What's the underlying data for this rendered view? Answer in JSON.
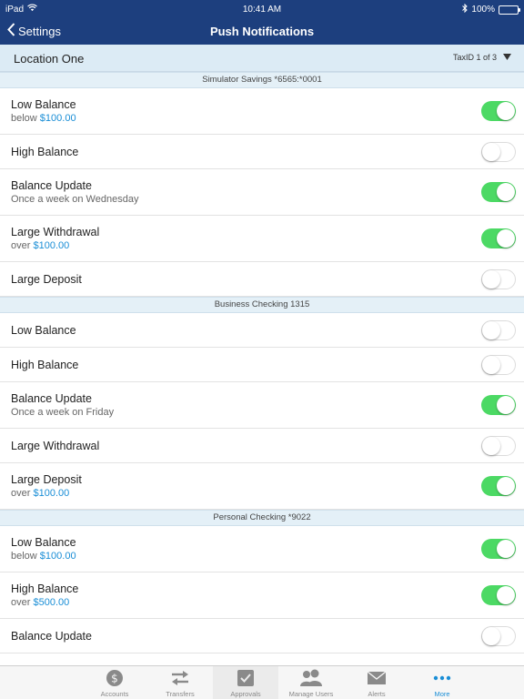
{
  "status_bar": {
    "device": "iPad",
    "time": "10:41 AM",
    "battery": "100%"
  },
  "nav": {
    "back_label": "Settings",
    "title": "Push Notifications"
  },
  "location": {
    "name": "Location One",
    "taxid": "TaxID 1 of 3"
  },
  "sections": [
    {
      "header": "Simulator Savings *6565:*0001",
      "rows": [
        {
          "title": "Low Balance",
          "prefix": "below ",
          "amount": "$100.00",
          "on": true
        },
        {
          "title": "High Balance",
          "on": false
        },
        {
          "title": "Balance Update",
          "prefix": "Once a week on Wednesday",
          "on": true
        },
        {
          "title": "Large Withdrawal",
          "prefix": "over ",
          "amount": "$100.00",
          "on": true
        },
        {
          "title": "Large Deposit",
          "on": false
        }
      ]
    },
    {
      "header": "Business Checking 1315",
      "rows": [
        {
          "title": "Low Balance",
          "on": false
        },
        {
          "title": "High Balance",
          "on": false
        },
        {
          "title": "Balance Update",
          "prefix": "Once a week on Friday",
          "on": true
        },
        {
          "title": "Large Withdrawal",
          "on": false
        },
        {
          "title": "Large Deposit",
          "prefix": "over ",
          "amount": "$100.00",
          "on": true
        }
      ]
    },
    {
      "header": "Personal Checking *9022",
      "rows": [
        {
          "title": "Low Balance",
          "prefix": "below ",
          "amount": "$100.00",
          "on": true
        },
        {
          "title": "High Balance",
          "prefix": "over ",
          "amount": "$500.00",
          "on": true
        },
        {
          "title": "Balance Update",
          "on": false
        }
      ]
    }
  ],
  "tabs": [
    {
      "label": "Accounts",
      "icon": "dollar-coin-icon"
    },
    {
      "label": "Transfers",
      "icon": "transfer-arrows-icon"
    },
    {
      "label": "Approvals",
      "icon": "checkbox-icon"
    },
    {
      "label": "Manage Users",
      "icon": "users-icon"
    },
    {
      "label": "Alerts",
      "icon": "envelope-icon"
    },
    {
      "label": "More",
      "icon": "more-dots-icon"
    }
  ],
  "colors": {
    "nav_bg": "#1d3f7e",
    "toggle_on": "#4cd964",
    "accent": "#1a8ed6",
    "section_bg": "#e4f0f7"
  }
}
